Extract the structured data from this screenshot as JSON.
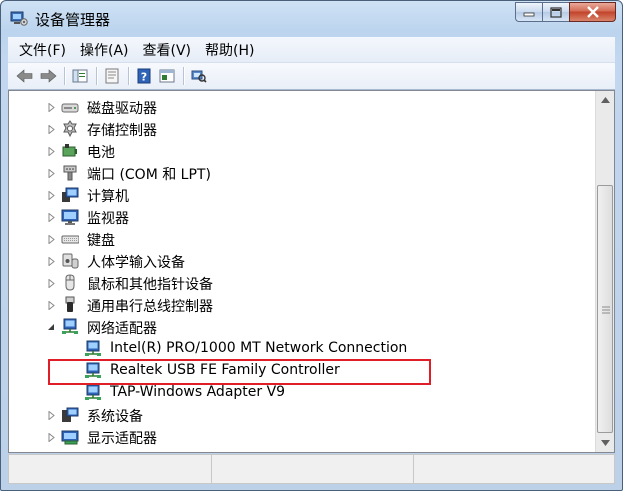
{
  "window": {
    "title": "设备管理器"
  },
  "menubar": {
    "items": [
      "文件(F)",
      "操作(A)",
      "查看(V)",
      "帮助(H)"
    ]
  },
  "toolbar": {
    "buttons": [
      "back-icon",
      "forward-icon",
      "console-tree-icon",
      "properties-icon",
      "help-icon",
      "view-icon",
      "scan-hardware-icon"
    ]
  },
  "tree": {
    "nodes": [
      {
        "label": "磁盘驱动器",
        "icon": "disk-drive-icon",
        "level": 0,
        "expander": "collapsed"
      },
      {
        "label": "存储控制器",
        "icon": "storage-controller-icon",
        "level": 0,
        "expander": "collapsed"
      },
      {
        "label": "电池",
        "icon": "battery-icon",
        "level": 0,
        "expander": "collapsed"
      },
      {
        "label": "端口 (COM 和 LPT)",
        "icon": "port-icon",
        "level": 0,
        "expander": "collapsed"
      },
      {
        "label": "计算机",
        "icon": "computer-icon",
        "level": 0,
        "expander": "collapsed"
      },
      {
        "label": "监视器",
        "icon": "monitor-icon",
        "level": 0,
        "expander": "collapsed"
      },
      {
        "label": "键盘",
        "icon": "keyboard-icon",
        "level": 0,
        "expander": "collapsed"
      },
      {
        "label": "人体学输入设备",
        "icon": "hid-icon",
        "level": 0,
        "expander": "collapsed"
      },
      {
        "label": "鼠标和其他指针设备",
        "icon": "mouse-icon",
        "level": 0,
        "expander": "collapsed"
      },
      {
        "label": "通用串行总线控制器",
        "icon": "usb-icon",
        "level": 0,
        "expander": "collapsed"
      },
      {
        "label": "网络适配器",
        "icon": "network-adapter-icon",
        "level": 0,
        "expander": "expanded"
      },
      {
        "label": "Intel(R) PRO/1000 MT Network Connection",
        "icon": "network-adapter-icon",
        "level": 1,
        "expander": "none"
      },
      {
        "label": "Realtek USB FE Family Controller",
        "icon": "network-adapter-icon",
        "level": 1,
        "expander": "none"
      },
      {
        "label": "TAP-Windows Adapter V9",
        "icon": "network-adapter-icon",
        "level": 1,
        "expander": "none"
      },
      {
        "label": "系统设备",
        "icon": "system-device-icon",
        "level": 0,
        "expander": "collapsed"
      },
      {
        "label": "显示适配器",
        "icon": "display-adapter-icon",
        "level": 0,
        "expander": "collapsed"
      }
    ]
  },
  "colors": {
    "highlight_border": "#e01e28",
    "title_gradient_top": "#cfe2f5"
  }
}
